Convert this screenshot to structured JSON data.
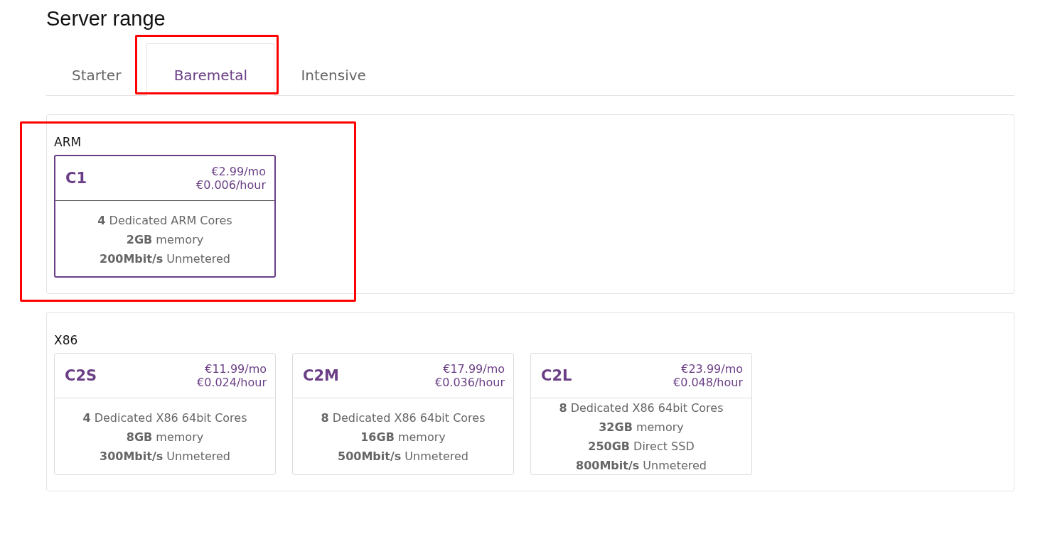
{
  "title": "Server range",
  "tabs": [
    {
      "label": "Starter",
      "selected": false
    },
    {
      "label": "Baremetal",
      "selected": true
    },
    {
      "label": "Intensive",
      "selected": false
    }
  ],
  "sections": [
    {
      "label": "ARM",
      "servers": [
        {
          "name": "C1",
          "price_month": "€2.99/mo",
          "price_hour": "€0.006/hour",
          "selected": true,
          "specs": [
            "**4** Dedicated ARM Cores",
            "**2GB** memory",
            "**200Mbit/s** Unmetered"
          ]
        }
      ]
    },
    {
      "label": "X86",
      "servers": [
        {
          "name": "C2S",
          "price_month": "€11.99/mo",
          "price_hour": "€0.024/hour",
          "selected": false,
          "specs": [
            "**4** Dedicated X86 64bit Cores",
            "**8GB** memory",
            "**300Mbit/s** Unmetered"
          ]
        },
        {
          "name": "C2M",
          "price_month": "€17.99/mo",
          "price_hour": "€0.036/hour",
          "selected": false,
          "specs": [
            "**8** Dedicated X86 64bit Cores",
            "**16GB** memory",
            "**500Mbit/s** Unmetered"
          ]
        },
        {
          "name": "C2L",
          "price_month": "€23.99/mo",
          "price_hour": "€0.048/hour",
          "selected": false,
          "specs": [
            "**8** Dedicated X86 64bit Cores",
            "**32GB** memory",
            "**250GB** Direct SSD",
            "**800Mbit/s** Unmetered"
          ]
        }
      ]
    }
  ]
}
